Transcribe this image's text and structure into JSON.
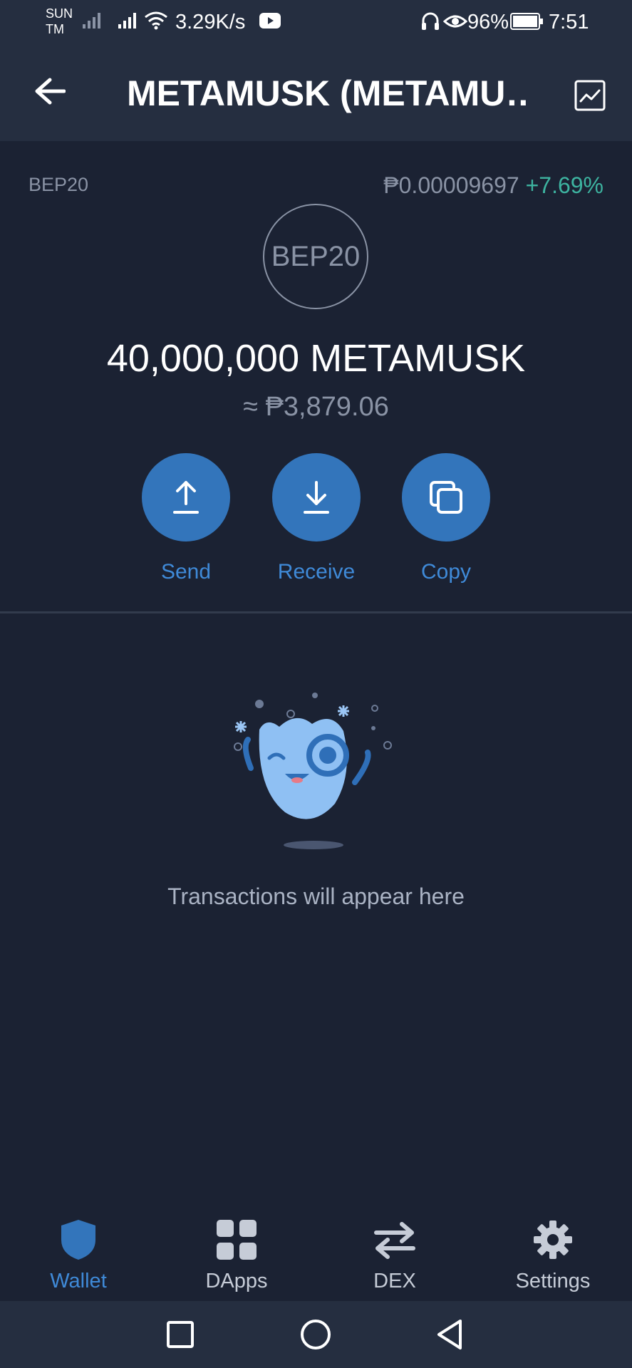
{
  "status_bar": {
    "carrier_top": "SUN",
    "carrier_bottom": "TM",
    "network_speed": "3.29K/s",
    "battery": "96%",
    "time": "7:51"
  },
  "header": {
    "title": "METAMUSK (METAMU…",
    "back_icon": "arrow-left-icon",
    "chart_icon": "chart-icon"
  },
  "token": {
    "network": "BEP20",
    "price": "₱0.00009697",
    "change": "+7.69%",
    "logo_text": "BEP20",
    "balance": "40,000,000 METAMUSK",
    "fiat_balance": "≈ ₱3,879.06"
  },
  "actions": [
    {
      "label": "Send",
      "icon": "upload-arrow-icon"
    },
    {
      "label": "Receive",
      "icon": "download-arrow-icon"
    },
    {
      "label": "Copy",
      "icon": "copy-icon"
    }
  ],
  "empty_state": {
    "message": "Transactions will appear here"
  },
  "bottom_nav": [
    {
      "label": "Wallet",
      "icon": "shield-icon",
      "active": true
    },
    {
      "label": "DApps",
      "icon": "grid-icon",
      "active": false
    },
    {
      "label": "DEX",
      "icon": "swap-arrows-icon",
      "active": false
    },
    {
      "label": "Settings",
      "icon": "gear-icon",
      "active": false
    }
  ],
  "colors": {
    "background": "#1b2233",
    "header": "#252e40",
    "accent": "#3375bb",
    "positive": "#3db3a0"
  }
}
